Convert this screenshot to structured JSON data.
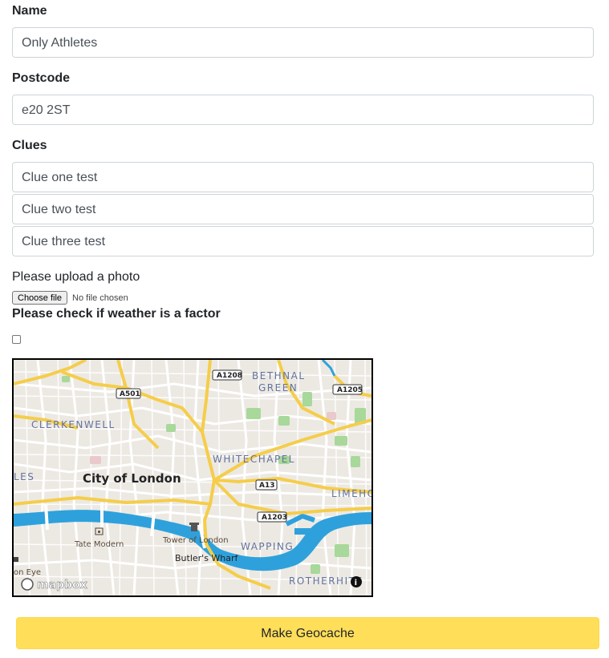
{
  "form": {
    "name_label": "Name",
    "name_value": "Only Athletes",
    "postcode_label": "Postcode",
    "postcode_value": "e20 2ST",
    "clues_label": "Clues",
    "clues": [
      "Clue one test",
      "Clue two test",
      "Clue three test"
    ],
    "photo_label": "Please upload a photo",
    "file_button": "Choose file",
    "file_status": "No file chosen",
    "weather_label": "Please check if weather is a factor",
    "weather_checked": false,
    "submit_label": "Make Geocache"
  },
  "map": {
    "places": {
      "bethnal": "BETHNAL",
      "green": "GREEN",
      "clerkenwell": "CLERKENWELL",
      "city": "City of London",
      "whitechapel": "WHITECHAPEL",
      "limehouse": "LIMEHO",
      "tate": "Tate Modern",
      "tower": "Tower of London",
      "butlers": "Butler's Wharf",
      "wapping": "WAPPING",
      "rotherhithe": "ROTHERHITE",
      "eye": "on Eye",
      "les": "LES"
    },
    "roads": [
      "A1208",
      "A501",
      "A1205",
      "A13",
      "A1203"
    ],
    "attribution": "mapbox",
    "colors": {
      "land": "#ece9e3",
      "water": "#2ea1dc",
      "park": "#a8d89a",
      "road_major": "#f5cd4a",
      "road_minor": "#ffffff"
    }
  }
}
